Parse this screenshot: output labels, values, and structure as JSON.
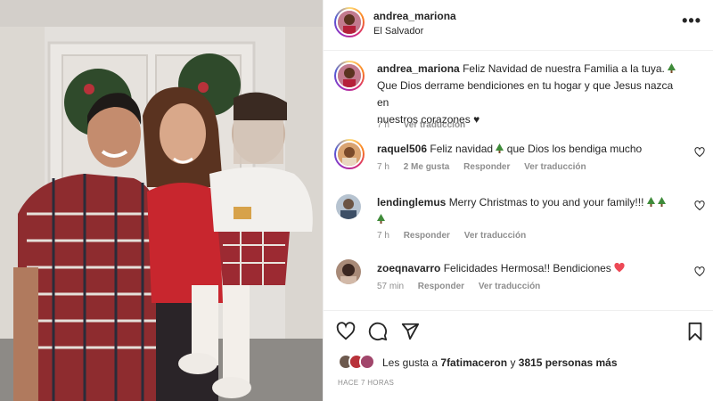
{
  "post": {
    "username": "andrea_mariona",
    "location": "El Salvador",
    "more_label": "•••"
  },
  "caption": {
    "username": "andrea_mariona",
    "text_line1": "Feliz Navidad de nuestra Familia a la tuya.",
    "text_line2": "Que Dios derrame bendiciones en tu hogar y que Jesus nazca en",
    "text_line3": "nuestros corazones",
    "heart": "♥",
    "time": "7 h",
    "translate": "Ver traducción"
  },
  "comments": [
    {
      "username": "raquel506",
      "text_a": "Feliz navidad",
      "text_b": "que Dios los bendiga mucho",
      "time": "7 h",
      "likes": "2 Me gusta",
      "reply": "Responder",
      "translate": "Ver traducción"
    },
    {
      "username": "lendinglemus",
      "text_a": "Merry Christmas to you and your family!!!",
      "time": "7 h",
      "reply": "Responder",
      "translate": "Ver traducción"
    },
    {
      "username": "zoeqnavarro",
      "text_a": "Felicidades Hermosa!! Bendiciones",
      "time": "57 min",
      "reply": "Responder",
      "translate": "Ver traducción"
    }
  ],
  "likes": {
    "prefix": "Les gusta a",
    "user": "7fatimaceron",
    "connector": "y",
    "count": "3815 personas más"
  },
  "timestamp": "HACE 7 HORAS",
  "colors": {
    "heart_red": "#ed4956",
    "muted_text": "#8e8e8e",
    "tree_green": "#3f8b3a"
  },
  "icons": [
    "more-options-icon",
    "heart-icon",
    "comment-icon",
    "share-icon",
    "bookmark-icon",
    "christmas-tree-icon"
  ]
}
